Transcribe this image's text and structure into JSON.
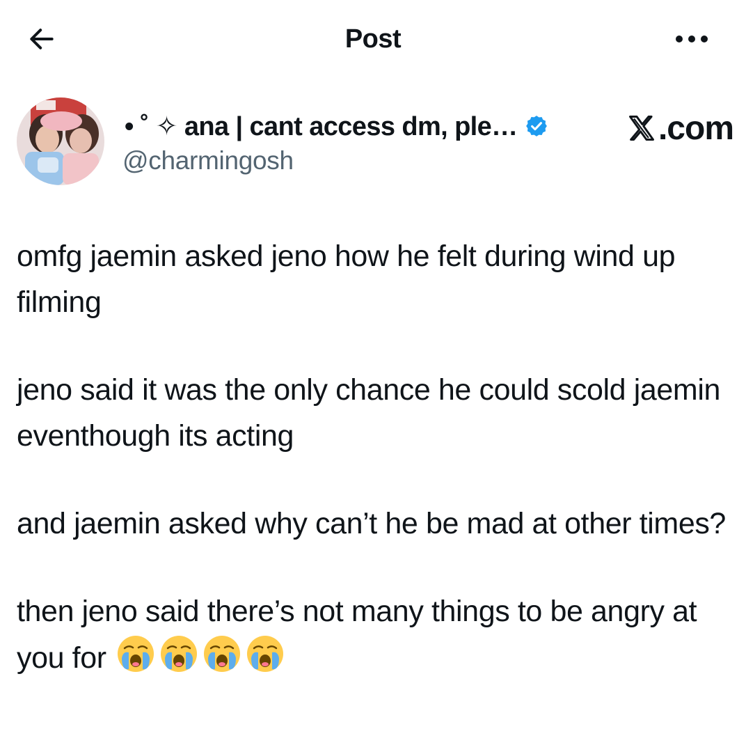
{
  "header": {
    "title": "Post",
    "back_icon": "arrow-left-icon",
    "more_icon": "more-horizontal-icon"
  },
  "author": {
    "display_name": "• ˚ ✧ ana | cant access dm, ple…",
    "handle": "@charmingosh",
    "verified": true,
    "verified_color": "#1d9bf0"
  },
  "watermark": {
    "text": ".com",
    "logo": "x-logo-icon"
  },
  "post": {
    "paragraphs": [
      "omfg jaemin asked jeno how he felt during wind up filming",
      "jeno said it was the only chance he could scold jaemin eventhough its acting",
      "and jaemin asked why can’t he be mad at other times?",
      "then jeno said there’s not many things to be angry at you for"
    ],
    "emojis": [
      "😭",
      "😭",
      "😭",
      "😭"
    ]
  },
  "colors": {
    "text": "#0f1419",
    "secondary_text": "#536471",
    "background": "#ffffff"
  }
}
